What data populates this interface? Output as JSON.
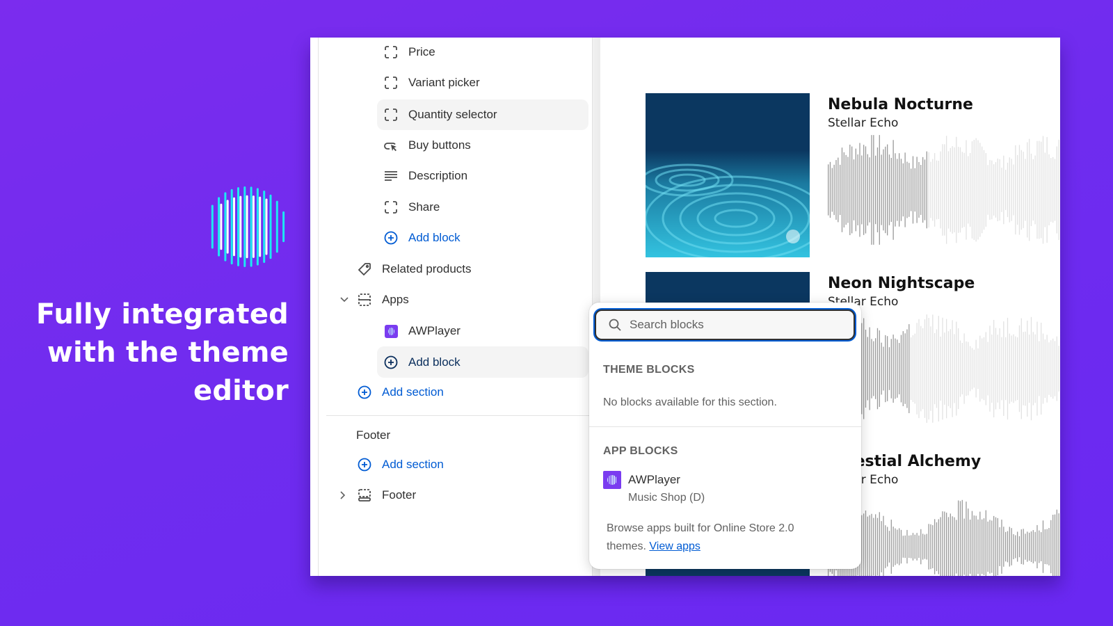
{
  "headline": {
    "line1": "Fully integrated",
    "line2": "with the theme",
    "line3": "editor"
  },
  "logo": {
    "icon": "awplayer-waveform-logo",
    "colors": {
      "cyan": "#1de9f2",
      "white": "#ffffff"
    }
  },
  "colors": {
    "background": "#7029ef",
    "accent_blue": "#005bd3",
    "text": "#303030",
    "muted": "#616161",
    "cover": "#0b3760"
  },
  "sidebar": {
    "blocks": [
      {
        "icon": "block-dashed-icon",
        "label": "Price"
      },
      {
        "icon": "block-dashed-icon",
        "label": "Variant picker"
      },
      {
        "icon": "block-dashed-icon",
        "label": "Quantity selector",
        "selected": true
      },
      {
        "icon": "cursor-click-icon",
        "label": "Buy buttons"
      },
      {
        "icon": "text-align-icon",
        "label": "Description"
      },
      {
        "icon": "block-dashed-icon",
        "label": "Share"
      }
    ],
    "add_block_label": "Add block",
    "related_products_label": "Related products",
    "apps_section": {
      "label": "Apps",
      "expanded": true,
      "items": [
        {
          "icon": "awplayer-app-icon",
          "label": "AWPlayer"
        }
      ],
      "add_block_label": "Add block"
    },
    "add_section_label": "Add section",
    "footer_group": {
      "title": "Footer",
      "add_section_label": "Add section",
      "section_label": "Footer",
      "expanded": false
    }
  },
  "preview": {
    "tracks": [
      {
        "title": "Nebula Nocturne",
        "artist": "Stellar Echo",
        "progress": 0.42
      },
      {
        "title": "Neon Nightscape",
        "artist": "Stellar Echo",
        "progress": 0.35
      },
      {
        "title": "Celestial Alchemy",
        "artist": "Stellar Echo",
        "progress": 1.0
      }
    ]
  },
  "popover": {
    "search_placeholder": "Search blocks",
    "theme_blocks_heading": "THEME BLOCKS",
    "theme_blocks_empty": "No blocks available for this section.",
    "app_blocks_heading": "APP BLOCKS",
    "app_blocks": [
      {
        "name": "AWPlayer",
        "source": "Music Shop (D)"
      }
    ],
    "browse_text": "Browse apps built for Online Store 2.0 themes.",
    "view_apps_label": "View apps"
  }
}
